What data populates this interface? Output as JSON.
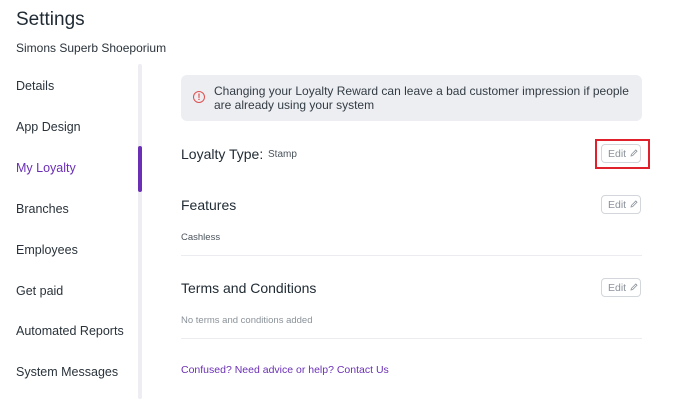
{
  "header": {
    "title": "Settings",
    "subtitle": "Simons Superb Shoeporium"
  },
  "sidebar": {
    "items": [
      {
        "label": "Details"
      },
      {
        "label": "App Design"
      },
      {
        "label": "My Loyalty",
        "active": true
      },
      {
        "label": "Branches"
      },
      {
        "label": "Employees"
      },
      {
        "label": "Get paid"
      },
      {
        "label": "Automated Reports"
      },
      {
        "label": "System Messages"
      }
    ]
  },
  "alert": {
    "icon": "alert-circle-icon",
    "icon_glyph": "!",
    "text": "Changing your Loyalty Reward can leave a bad customer impression if people are already using your system"
  },
  "loyalty_type": {
    "label": "Loyalty Type:",
    "value": "Stamp",
    "edit_label": "Edit"
  },
  "features": {
    "title": "Features",
    "value": "Cashless",
    "edit_label": "Edit"
  },
  "terms": {
    "title": "Terms and Conditions",
    "value": "No terms and conditions added",
    "edit_label": "Edit"
  },
  "help_link": "Confused? Need advice or help? Contact Us",
  "colors": {
    "accent": "#6a2fb5",
    "alert_bg": "#eceef2",
    "alert_icon": "#e05050",
    "highlight": "#e0202a"
  }
}
